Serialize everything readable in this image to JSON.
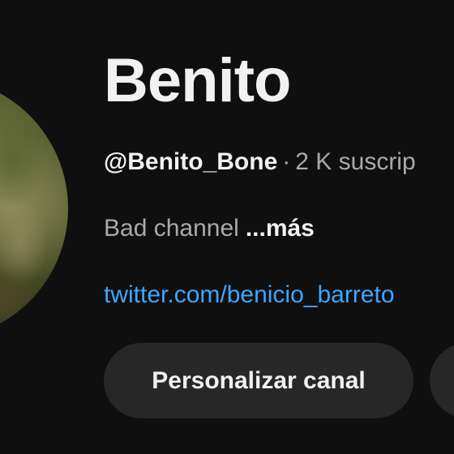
{
  "channel": {
    "name": "Benito",
    "handle": "@Benito_Bone",
    "separator": "·",
    "subscribers": "2 K suscrip",
    "description": "Bad channel",
    "more_label": "...más",
    "link": "twitter.com/benicio_barreto"
  },
  "actions": {
    "customize_label": "Personalizar canal"
  }
}
